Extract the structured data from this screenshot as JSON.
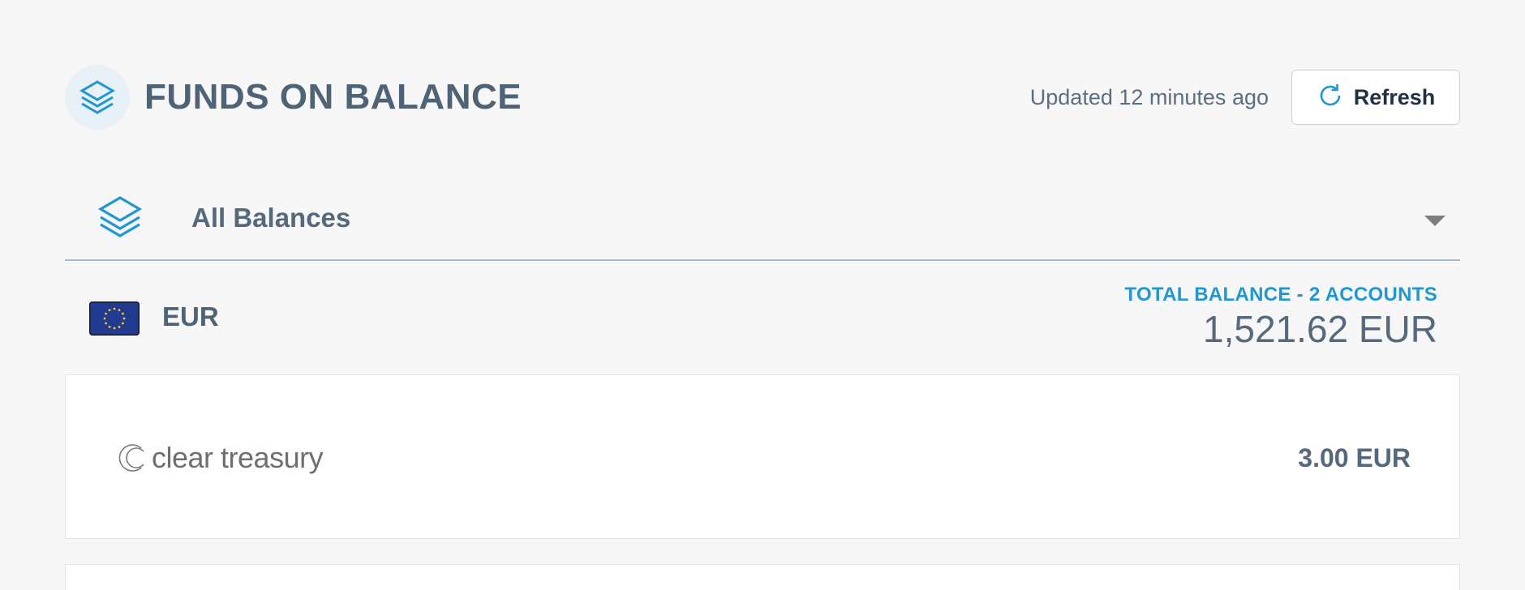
{
  "header": {
    "title": "FUNDS ON BALANCE",
    "title_icon": "layers-icon",
    "updated_text": "Updated 12 minutes ago",
    "refresh_label": "Refresh",
    "refresh_icon": "refresh-icon"
  },
  "balance_select": {
    "icon": "layers-icon",
    "selected": "All Balances"
  },
  "currency": {
    "code": "EUR",
    "flag": "eu-flag-icon",
    "total_label": "TOTAL BALANCE - 2 ACCOUNTS",
    "total_amount": "1,521.62 EUR"
  },
  "accounts": [
    {
      "name": "clear treasury",
      "amount": "3.00 EUR"
    }
  ],
  "colors": {
    "accent": "#2196d0",
    "text": "#4f6377",
    "background": "#f7f7f7"
  }
}
